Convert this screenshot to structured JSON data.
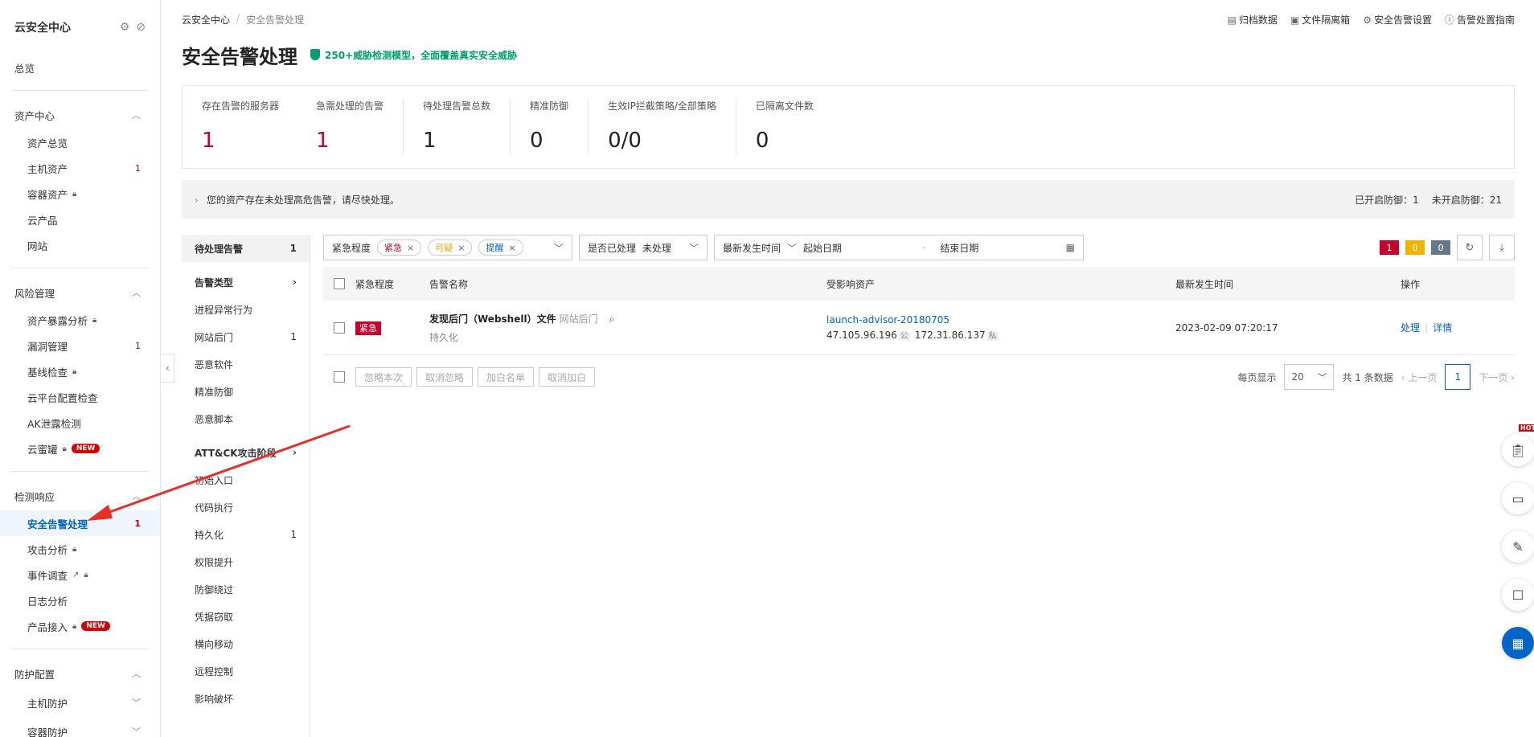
{
  "sidebar": {
    "title": "云安全中心",
    "overview": "总览",
    "groups": [
      {
        "label": "资产中心",
        "items": [
          {
            "label": "资产总览",
            "count": "",
            "lock": false,
            "badge": ""
          },
          {
            "label": "主机资产",
            "count": "1",
            "lock": false,
            "badge": ""
          },
          {
            "label": "容器资产",
            "count": "",
            "lock": true,
            "badge": ""
          },
          {
            "label": "云产品",
            "count": "",
            "lock": false,
            "badge": ""
          },
          {
            "label": "网站",
            "count": "",
            "lock": false,
            "badge": ""
          }
        ]
      },
      {
        "label": "风险管理",
        "items": [
          {
            "label": "资产暴露分析",
            "count": "",
            "lock": true,
            "badge": ""
          },
          {
            "label": "漏洞管理",
            "count": "1",
            "lock": false,
            "badge": ""
          },
          {
            "label": "基线检查",
            "count": "",
            "lock": true,
            "badge": ""
          },
          {
            "label": "云平台配置检查",
            "count": "",
            "lock": false,
            "badge": ""
          },
          {
            "label": "AK泄露检测",
            "count": "",
            "lock": false,
            "badge": ""
          },
          {
            "label": "云蜜罐",
            "count": "",
            "lock": true,
            "badge": "NEW"
          }
        ]
      },
      {
        "label": "检测响应",
        "items": [
          {
            "label": "安全告警处理",
            "count": "1",
            "lock": false,
            "badge": "",
            "active": true
          },
          {
            "label": "攻击分析",
            "count": "",
            "lock": true,
            "badge": ""
          },
          {
            "label": "事件调查",
            "count": "",
            "lock": true,
            "badge": "",
            "external": true
          },
          {
            "label": "日志分析",
            "count": "",
            "lock": false,
            "badge": ""
          },
          {
            "label": "产品接入",
            "count": "",
            "lock": true,
            "badge": "NEW"
          }
        ]
      },
      {
        "label": "防护配置",
        "items": [
          {
            "label": "主机防护",
            "count": "",
            "lock": false,
            "badge": "",
            "expandable": true
          },
          {
            "label": "容器防护",
            "count": "",
            "lock": false,
            "badge": "",
            "expandable": true
          }
        ]
      }
    ]
  },
  "breadcrumb": {
    "root": "云安全中心",
    "sep": "/",
    "current": "安全告警处理"
  },
  "toplinks": [
    "归档数据",
    "文件隔离箱",
    "安全告警设置",
    "告警处置指南"
  ],
  "page": {
    "title": "安全告警处理",
    "tag": "250+威胁检测模型，全面覆盖真实安全威胁"
  },
  "stats": {
    "servers_label": "存在告警的服务器",
    "servers_value": "1",
    "urgent_label": "急需处理的告警",
    "urgent_value": "1",
    "pending_label": "待处理告警总数",
    "pending_value": "1",
    "precise_label": "精准防御",
    "precise_value": "0",
    "ip_label": "生效IP拦截策略/全部策略",
    "ip_value": "0/0",
    "isolated_label": "已隔离文件数",
    "isolated_value": "0"
  },
  "notice": {
    "text": "您的资产存在未处理高危告警，请尽快处理。",
    "enabled_label": "已开启防御：",
    "enabled": "1",
    "disabled_label": "未开启防御：",
    "disabled": "21"
  },
  "filter_panel": {
    "pending": {
      "label": "待处理告警",
      "count": "1"
    },
    "type_label": "告警类型",
    "types": [
      {
        "label": "进程异常行为",
        "count": ""
      },
      {
        "label": "网站后门",
        "count": "1"
      },
      {
        "label": "恶意软件",
        "count": ""
      },
      {
        "label": "精准防御",
        "count": ""
      },
      {
        "label": "恶意脚本",
        "count": ""
      }
    ],
    "attack_label": "ATT&CK攻击阶段",
    "stages": [
      {
        "label": "初始入口",
        "count": ""
      },
      {
        "label": "代码执行",
        "count": ""
      },
      {
        "label": "持久化",
        "count": "1"
      },
      {
        "label": "权限提升",
        "count": ""
      },
      {
        "label": "防御绕过",
        "count": ""
      },
      {
        "label": "凭据窃取",
        "count": ""
      },
      {
        "label": "横向移动",
        "count": ""
      },
      {
        "label": "远程控制",
        "count": ""
      },
      {
        "label": "影响破坏",
        "count": ""
      }
    ]
  },
  "toolbar": {
    "level_label": "紧急程度",
    "chips": [
      "紧急",
      "可疑",
      "提醒"
    ],
    "handled_label": "是否已处理",
    "handled_value": "未处理",
    "time_label": "最新发生时间",
    "start_placeholder": "起始日期",
    "dash": "-",
    "end_placeholder": "结束日期",
    "counts": [
      "1",
      "0",
      "0"
    ]
  },
  "table": {
    "headers": [
      "紧急程度",
      "告警名称",
      "受影响资产",
      "最新发生时间",
      "操作"
    ],
    "rows": [
      {
        "level": "紧急",
        "name": "发现后门（Webshell）文件",
        "sub": "网站后门",
        "tag": "持久化",
        "asset": "launch-advisor-20180705",
        "ip_public": "47.105.96.196",
        "pub": "公",
        "ip_private": "172.31.86.137",
        "priv": "私",
        "time": "2023-02-09 07:20:17",
        "op_handle": "处理",
        "op_detail": "详情"
      }
    ]
  },
  "footer": {
    "buttons": [
      "忽略本次",
      "取消忽略",
      "加白名单",
      "取消加白"
    ],
    "per_page_label": "每页显示",
    "per_page": "20",
    "total": "共 1 条数据",
    "prev": "上一页",
    "page": "1",
    "next": "下一页"
  },
  "floatbar": {
    "hot": "HOT"
  },
  "colors": {
    "accent": "#0064c8",
    "danger": "#c8002a",
    "success": "#00a070",
    "warning": "#f0b400"
  }
}
